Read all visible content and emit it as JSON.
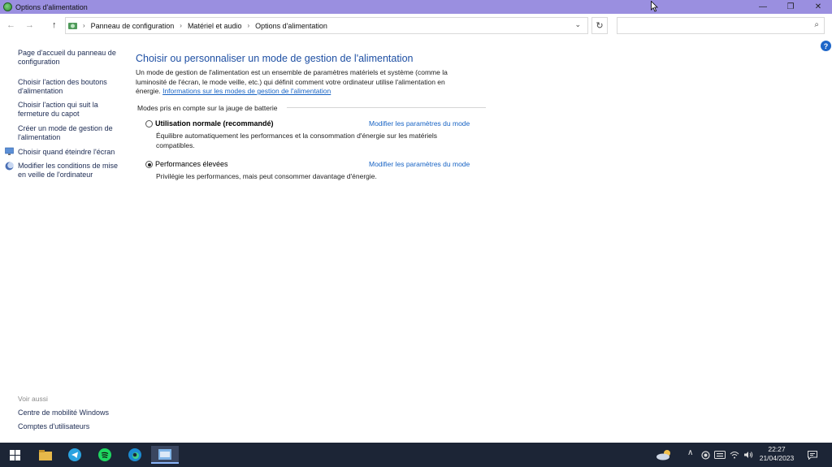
{
  "window": {
    "title": "Options d'alimentation",
    "controls": {
      "minimize": "—",
      "maximize": "❐",
      "close": "✕"
    }
  },
  "nav": {
    "back": "←",
    "forward": "→",
    "up": "↑"
  },
  "address": {
    "crumbs": [
      "Panneau de configuration",
      "Matériel et audio",
      "Options d'alimentation"
    ],
    "separator": "›",
    "dropdown": "⌄",
    "refresh": "↻"
  },
  "search": {
    "placeholder": "",
    "icon": "⌕"
  },
  "help": {
    "label": "?"
  },
  "sidebar": {
    "home_lines": [
      "Page d'accueil du panneau de",
      "configuration"
    ],
    "items": [
      [
        "Choisir l'action des boutons",
        "d'alimentation"
      ],
      [
        "Choisir l'action qui suit la",
        "fermeture du capot"
      ],
      [
        "Créer un mode de gestion de",
        "l'alimentation"
      ],
      [
        "Choisir quand éteindre l'écran"
      ],
      [
        "Modifier les conditions de mise",
        "en veille de l'ordinateur"
      ]
    ],
    "see_also": "Voir aussi",
    "see_also_items": [
      "Centre de mobilité Windows",
      "Comptes d'utilisateurs"
    ]
  },
  "main": {
    "title": "Choisir ou personnaliser un mode de gestion de l'alimentation",
    "desc_lines": [
      "Un mode de gestion de l'alimentation est un ensemble de paramètres matériels et système (comme la",
      "luminosité de l'écran, le mode veille, etc.) qui définit comment votre ordinateur utilise l'alimentation en",
      "énergie."
    ],
    "info_link": "Informations sur les modes de gestion de l'alimentation",
    "group_label": "Modes pris en compte sur la jauge de batterie",
    "plans": [
      {
        "name": "Utilisation normale (recommandé)",
        "desc_lines": [
          "Équilibre automatiquement les performances et la consommation d'énergie sur les matériels",
          "compatibles."
        ],
        "link": "Modifier les paramètres du mode",
        "selected": false
      },
      {
        "name": "Performances élevées",
        "desc_lines": [
          "Privilégie les performances, mais peut consommer davantage d'énergie."
        ],
        "link": "Modifier les paramètres du mode",
        "selected": true
      }
    ]
  },
  "taskbar": {
    "tray": {
      "chevron": "∧",
      "time": "22:27",
      "date": "21/04/2023"
    },
    "apps": [
      "windows-start-icon",
      "file-explorer-icon",
      "telegram-icon",
      "spotify-icon",
      "edge-icon",
      "control-panel-icon"
    ]
  },
  "colors": {
    "titlebar": "#9a8fe0",
    "link": "#1763c4",
    "heading": "#1e4fa3",
    "taskbar": "#1c2536"
  }
}
